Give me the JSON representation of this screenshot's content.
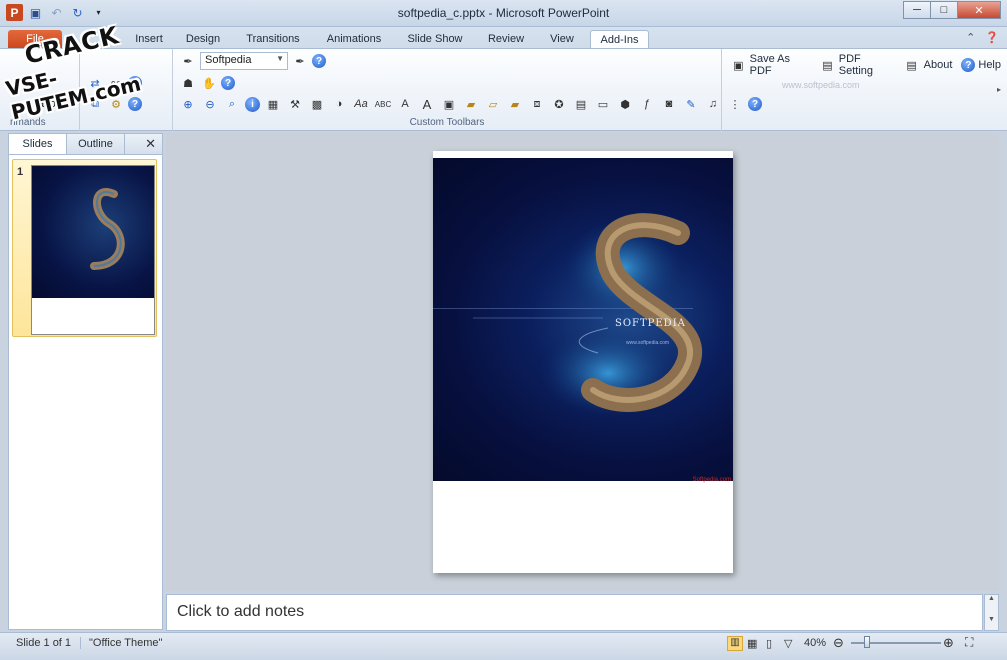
{
  "window": {
    "title": "softpedia_c.pptx - Microsoft PowerPoint",
    "app_icon": "P",
    "controls": [
      "─",
      "□",
      "✕"
    ]
  },
  "tabs": [
    {
      "label": "File"
    },
    {
      "label": "Insert"
    },
    {
      "label": "Design"
    },
    {
      "label": "Transitions"
    },
    {
      "label": "Animations"
    },
    {
      "label": "Slide Show"
    },
    {
      "label": "Review"
    },
    {
      "label": "View"
    },
    {
      "label": "Add-Ins"
    }
  ],
  "ribbon": {
    "left_group_label": "nmands",
    "left_group_item": "ation",
    "combo_value": "Softpedia",
    "custom_toolbars_label": "Custom Toolbars",
    "save_pdf": "Save As PDF",
    "pdf_setting": "PDF Setting",
    "about": "About",
    "help": "Help",
    "watermark_url": "www.softpedia.com"
  },
  "leftpane": {
    "tab_slides": "Slides",
    "tab_outline": "Outline",
    "close": "✕",
    "slide_number": "1"
  },
  "slide": {
    "brand": "SOFTPEDIA",
    "url": "www.softpedia.com",
    "corner_text": "Softpedia.com"
  },
  "notes": {
    "placeholder": "Click to add notes"
  },
  "status": {
    "slide_info": "Slide 1 of 1",
    "theme": "\"Office Theme\"",
    "zoom": "40%",
    "zoom_level": 0.4
  },
  "overlay": {
    "line1": "CRACK",
    "line2": "VSE-PUTEM.com"
  },
  "colors": {
    "file_tab": "#c9461f",
    "ribbon_bg": "#fdfeff",
    "slide_bg": "#07103f",
    "selection": "#fde59a"
  }
}
